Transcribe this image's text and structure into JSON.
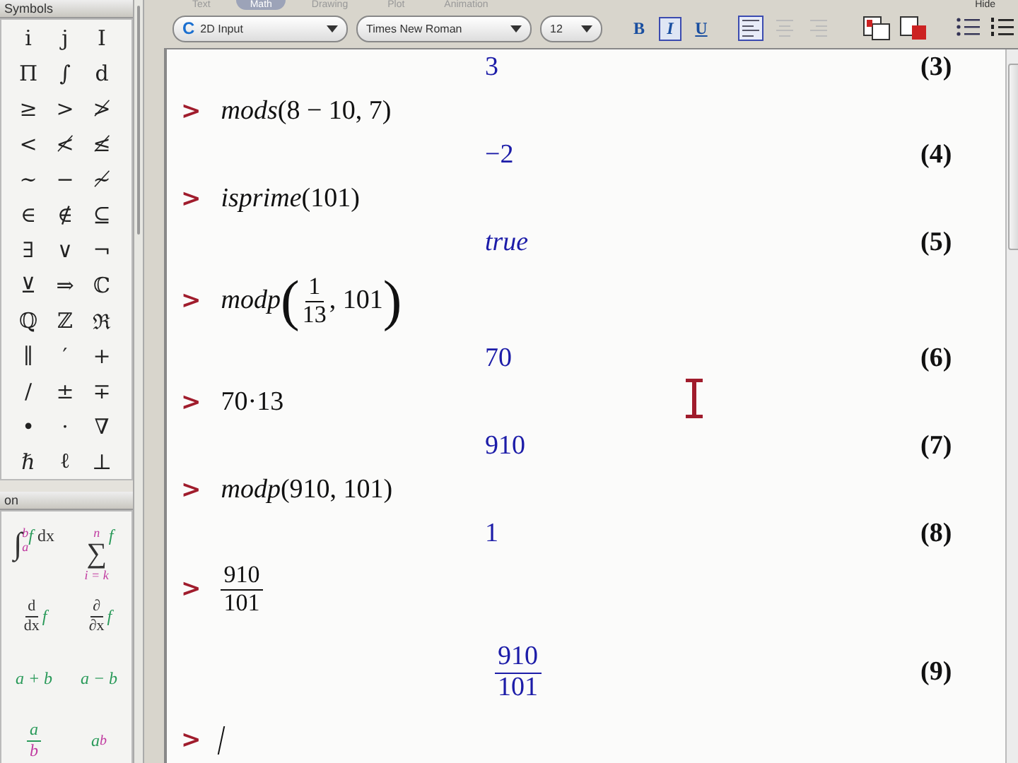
{
  "ribbon_tabs": [
    {
      "label": "Text",
      "selected": false
    },
    {
      "label": "Math",
      "selected": true
    },
    {
      "label": "Drawing",
      "selected": false
    },
    {
      "label": "Plot",
      "selected": false
    },
    {
      "label": "Animation",
      "selected": false
    }
  ],
  "ribbon_hide": "Hide",
  "toolbar": {
    "mode": {
      "icon": "C",
      "value": "2D Input"
    },
    "font": "Times New Roman",
    "size": "12",
    "styles": [
      {
        "label": "B",
        "selected": false
      },
      {
        "label": "I",
        "selected": true
      },
      {
        "label": "U",
        "selected": false
      }
    ],
    "alignment": [
      {
        "kind": "left",
        "selected": true
      },
      {
        "kind": "center",
        "selected": false
      },
      {
        "kind": "right",
        "selected": false
      }
    ]
  },
  "symbols_palette": {
    "title": "Symbols",
    "rows": [
      [
        "i",
        "j",
        "I"
      ],
      [
        "Π",
        "∫",
        "d"
      ],
      [
        "≥",
        ">",
        "≯"
      ],
      [
        "<",
        "≮",
        "≰"
      ],
      [
        "∼",
        "−",
        "≁"
      ],
      [
        "∈",
        "∉",
        "⊆"
      ],
      [
        "∃",
        "∨",
        "¬"
      ],
      [
        "⊻",
        "⇒",
        "ℂ"
      ],
      [
        "ℚ",
        "ℤ",
        "ℜ"
      ],
      [
        "∥",
        "′",
        "+"
      ],
      [
        "/",
        "±",
        "∓"
      ],
      [
        "•",
        "·",
        "∇"
      ],
      [
        "ℏ",
        "ℓ",
        "⊥"
      ]
    ]
  },
  "expression_palette": {
    "title": "on",
    "items": [
      {
        "kind": "integral",
        "sign": "∫",
        "upper": "b",
        "lower": "a",
        "body": "f",
        "tail": "dx"
      },
      {
        "kind": "sum",
        "upper": "n",
        "sign": "∑",
        "lower": "i = k",
        "body": "f"
      },
      {
        "kind": "derivative",
        "numerator": "d",
        "denominator": "dx",
        "body": "f"
      },
      {
        "kind": "derivative",
        "numerator": "∂",
        "denominator": "∂x",
        "body": "f"
      },
      {
        "kind": "plain",
        "text": "a + b"
      },
      {
        "kind": "plain",
        "text": "a − b"
      },
      {
        "kind": "fraction",
        "numerator": "a",
        "denominator": "b"
      },
      {
        "kind": "power",
        "base": "a",
        "exponent": "b"
      }
    ]
  },
  "worksheet": [
    {
      "output": {
        "kind": "number",
        "text": "3"
      },
      "label": "(3)"
    },
    {
      "input": {
        "kind": "call",
        "func": "mods",
        "args": "(8 − 10, 7)"
      },
      "output": {
        "kind": "number",
        "text": "−2"
      },
      "label": "(4)"
    },
    {
      "input": {
        "kind": "call",
        "func": "isprime",
        "args": "(101)"
      },
      "output": {
        "kind": "italic",
        "text": "true"
      },
      "label": "(5)"
    },
    {
      "input": {
        "kind": "call_fraction",
        "func": "modp",
        "open": "(",
        "numerator": "1",
        "denominator": "13",
        "tail": ", 101",
        "close": ")"
      },
      "output": {
        "kind": "number",
        "text": "70"
      },
      "label": "(6)"
    },
    {
      "input": {
        "kind": "plain",
        "text": "70·13"
      },
      "output": {
        "kind": "number",
        "text": "910"
      },
      "label": "(7)"
    },
    {
      "input": {
        "kind": "call",
        "func": "modp",
        "args": "(910, 101)"
      },
      "output": {
        "kind": "number",
        "text": "1"
      },
      "label": "(8)"
    },
    {
      "input": {
        "kind": "fraction",
        "numerator": "910",
        "denominator": "101"
      },
      "output": {
        "kind": "fraction",
        "numerator": "910",
        "denominator": "101"
      },
      "label": "(9)"
    },
    {
      "input": {
        "kind": "cursor"
      }
    }
  ],
  "prompt": ">"
}
